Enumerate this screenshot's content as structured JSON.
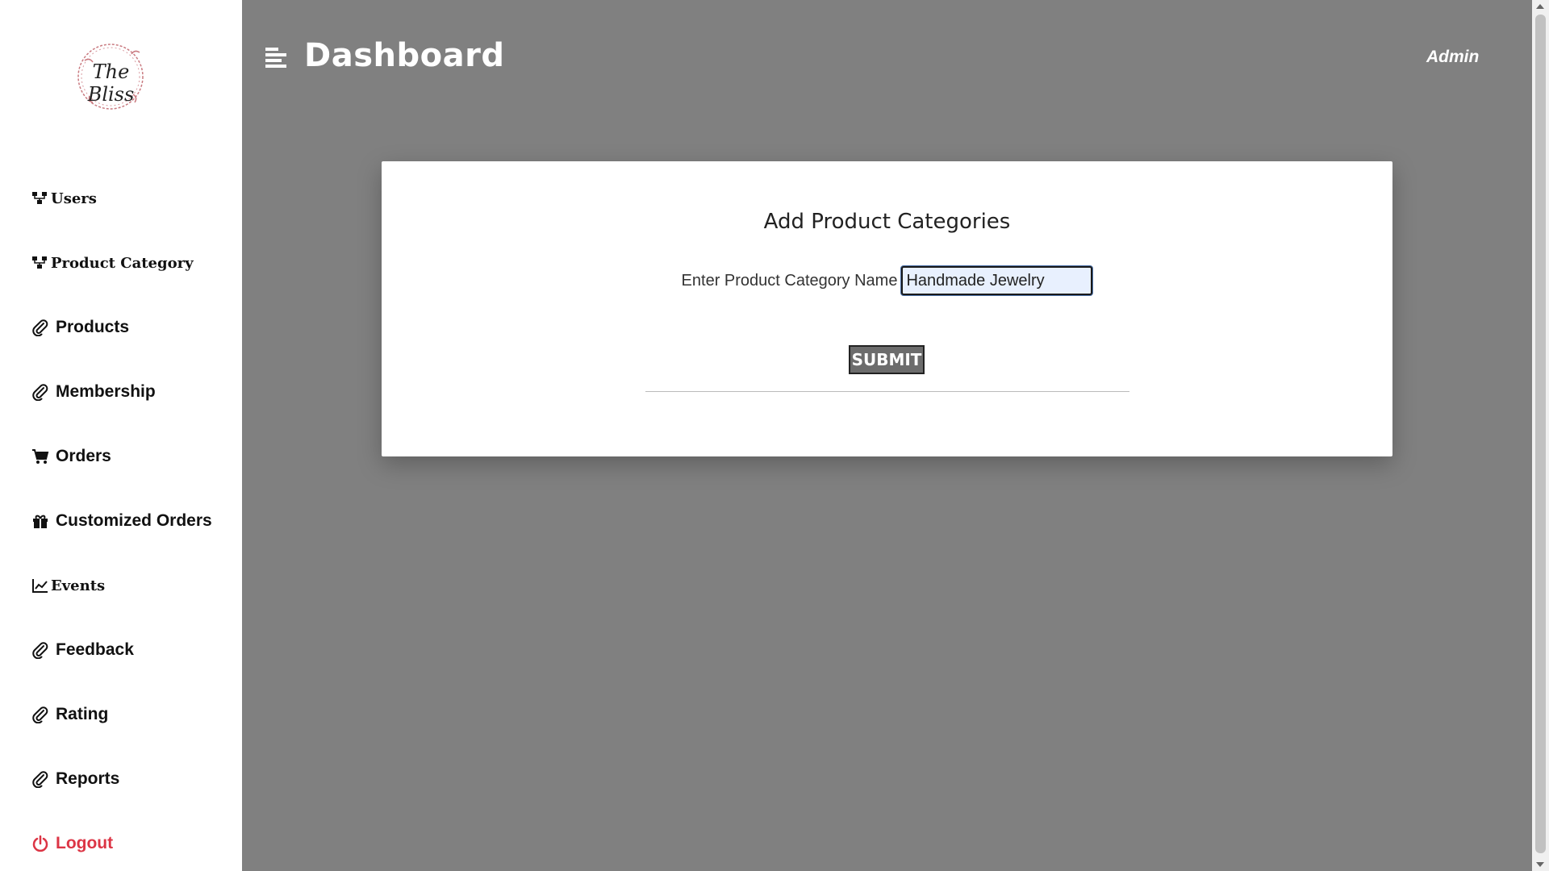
{
  "brand": {
    "logo_text": "The Bliss",
    "logo_icon": "floral-wreath-logo"
  },
  "sidebar": {
    "items": [
      {
        "label": "Users",
        "icon": "sitemap-icon"
      },
      {
        "label": "Product Category",
        "icon": "sitemap-icon"
      },
      {
        "label": "Products",
        "icon": "paperclip-icon"
      },
      {
        "label": "Membership",
        "icon": "paperclip-icon"
      },
      {
        "label": "Orders",
        "icon": "cart-icon"
      },
      {
        "label": "Customized Orders",
        "icon": "gift-icon"
      },
      {
        "label": "Events",
        "icon": "chart-line-icon"
      },
      {
        "label": "Feedback",
        "icon": "paperclip-icon"
      },
      {
        "label": "Rating",
        "icon": "paperclip-icon"
      },
      {
        "label": "Reports",
        "icon": "paperclip-icon"
      },
      {
        "label": "Logout",
        "icon": "power-icon"
      }
    ]
  },
  "header": {
    "title": "Dashboard",
    "user": "Admin",
    "menu_icon": "menu-icon"
  },
  "form": {
    "title": "Add Product Categories",
    "label": "Enter Product Category Name",
    "value": "Handmade Jewelry",
    "submit": "SUBMIT"
  },
  "colors": {
    "background": "#808080",
    "logout": "#dc3545",
    "input_bg": "#e8f0fe"
  }
}
